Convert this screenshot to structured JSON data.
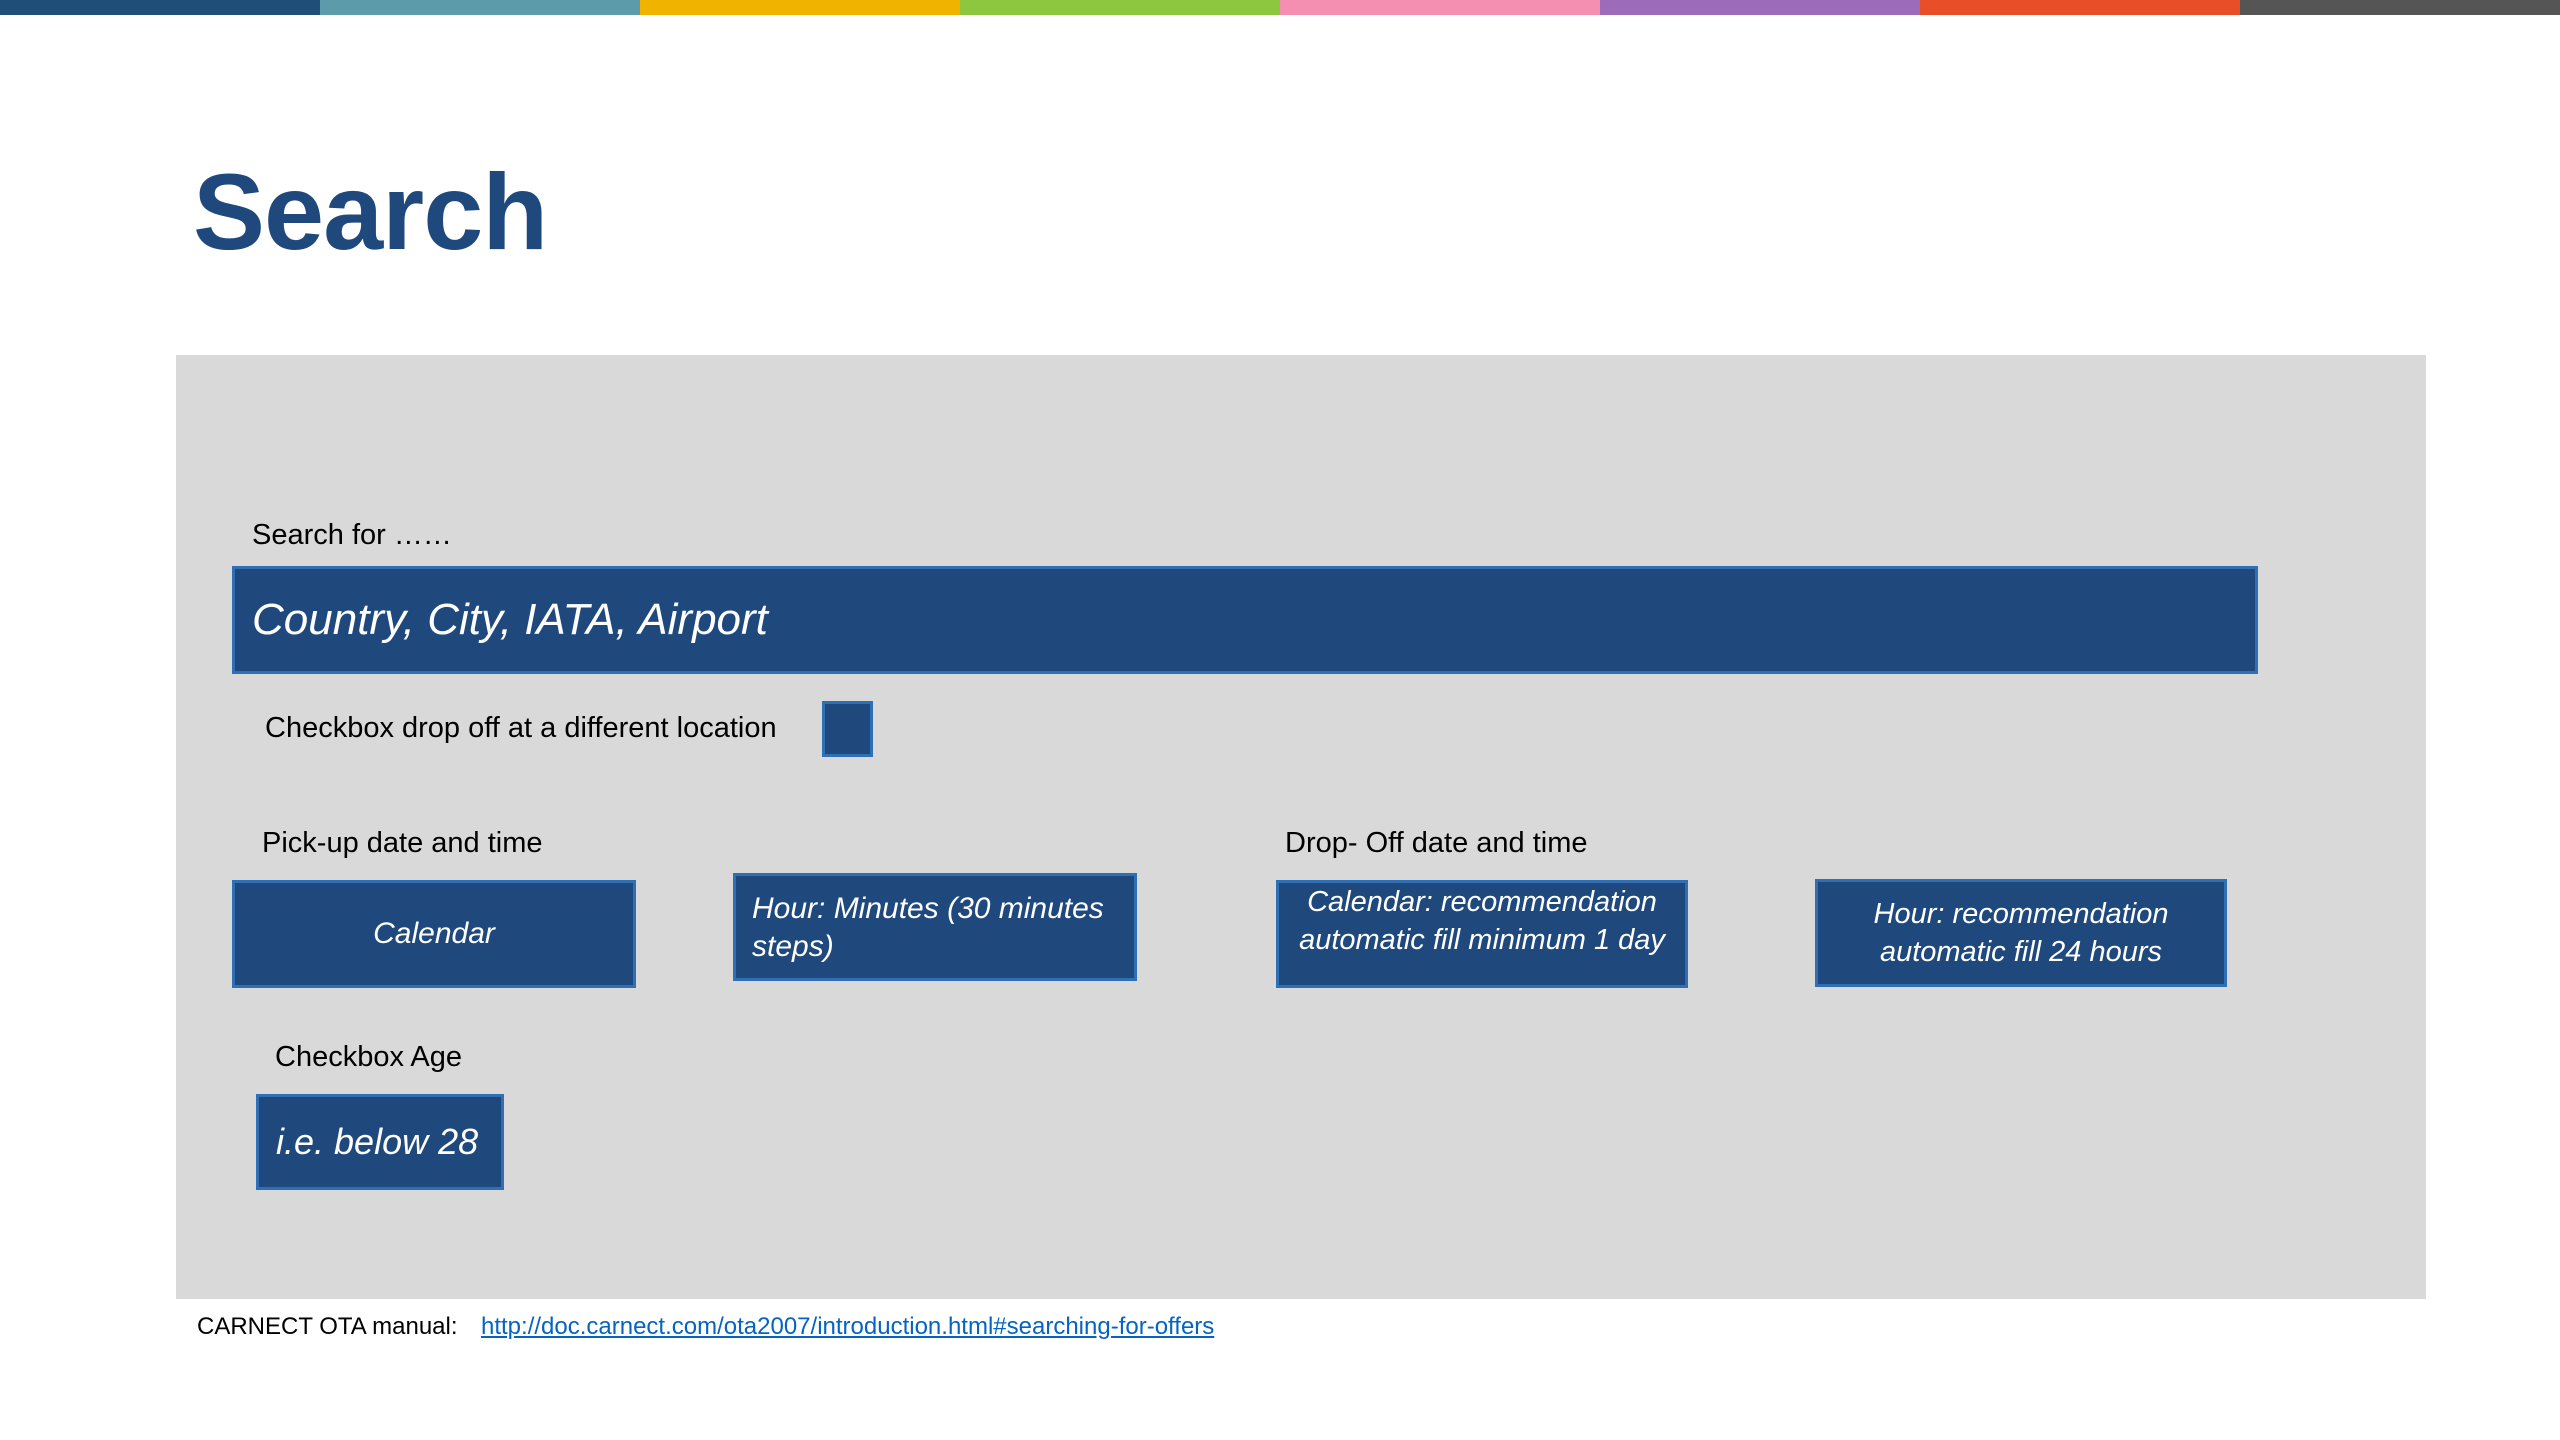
{
  "colors": {
    "stripe": [
      "#1F4E79",
      "#5B9BAA",
      "#F0B400",
      "#8DC63F",
      "#F48FB1",
      "#9C6BBA",
      "#E84E27",
      "#555555"
    ],
    "title": "#1F497D",
    "panel": "#D9D9D9",
    "box_fill": "#1F497D",
    "box_border": "#2F6FB5",
    "link": "#0563C1"
  },
  "title": "Search",
  "search": {
    "label": "Search for ……",
    "placeholder": "Country, City, IATA, Airport"
  },
  "dropoff_location": {
    "label": "Checkbox drop off at a different location"
  },
  "pickup": {
    "label": "Pick-up date and time",
    "calendar": "Calendar",
    "hour": "Hour: Minutes (30 minutes steps)"
  },
  "dropoff": {
    "label": "Drop- Off date and time",
    "calendar": "Calendar: recommendation automatic fill minimum 1 day",
    "hour": "Hour: recommendation automatic fill 24 hours"
  },
  "age": {
    "label": "Checkbox Age",
    "value": "i.e. below 28"
  },
  "footer": {
    "label": "CARNECT OTA manual:",
    "link_text": "http://doc.carnect.com/ota2007/introduction.html#searching-for-offers"
  }
}
